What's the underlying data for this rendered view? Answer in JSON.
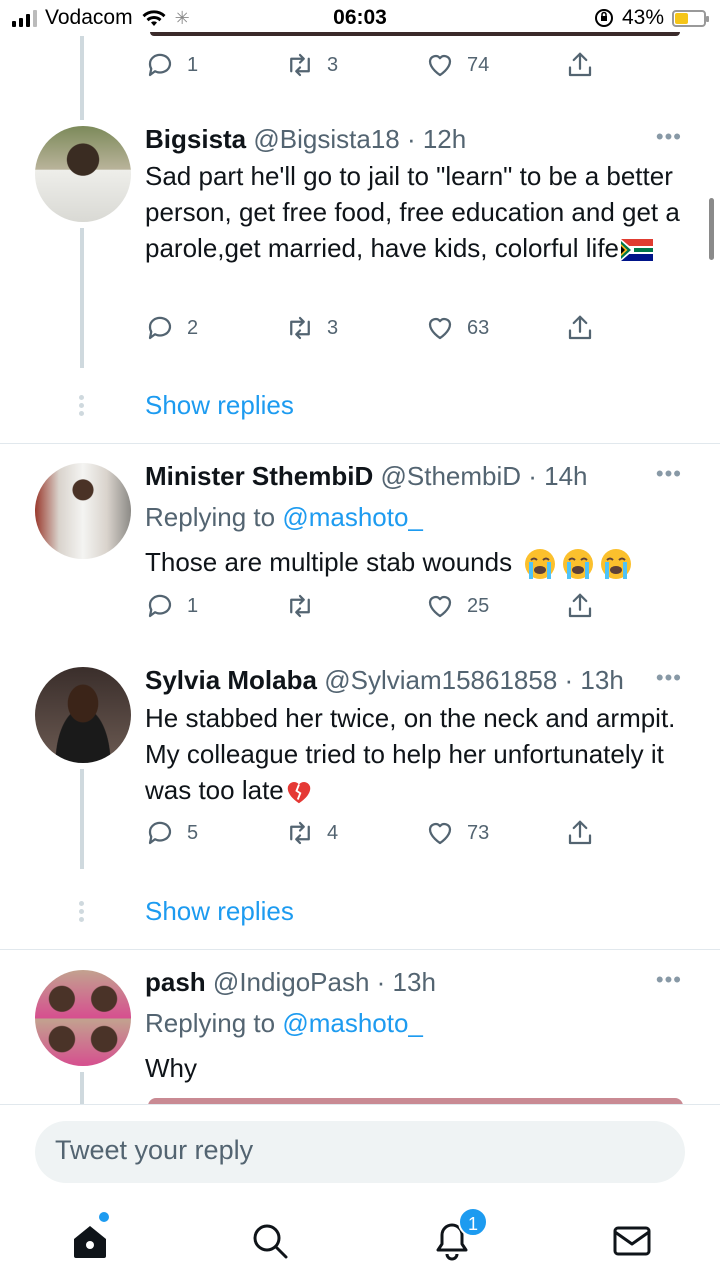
{
  "status_bar": {
    "carrier": "Vodacom",
    "time": "06:03",
    "battery": "43%"
  },
  "prev_tweet_actions": {
    "replies": "1",
    "retweets": "3",
    "likes": "74"
  },
  "tweets": [
    {
      "name": "Bigsista",
      "handle": "@Bigsista18 · 12h",
      "body": "Sad part he'll go to jail to \"learn\" to be a better person, get free food, free education and get a parole,get married, have kids, colorful life",
      "replies": "2",
      "retweets": "3",
      "likes": "63",
      "show_replies": "Show replies"
    },
    {
      "name": "Minister SthembiD",
      "handle": "@SthembiD · 14h",
      "replying_prefix": "Replying to ",
      "replying_to": "@mashoto_",
      "body": "Those are multiple stab wounds",
      "replies": "1",
      "retweets": "",
      "likes": "25"
    },
    {
      "name": "Sylvia Molaba",
      "handle": "@Sylviam15861858 · 13h",
      "body": "He stabbed her twice, on the neck and armpit. My colleague tried to help her unfortunately it was too late",
      "replies": "5",
      "retweets": "4",
      "likes": "73",
      "show_replies": "Show replies"
    },
    {
      "name": "pash",
      "handle": "@IndigoPash · 13h",
      "replying_prefix": "Replying to ",
      "replying_to": "@mashoto_",
      "body": "Why"
    }
  ],
  "reply_bar": {
    "placeholder": "Tweet your reply"
  },
  "tab_bar": {
    "notifications_badge": "1"
  },
  "colors": {
    "accent": "#1d9bf0",
    "text": "#0f1419",
    "muted": "#536471"
  }
}
